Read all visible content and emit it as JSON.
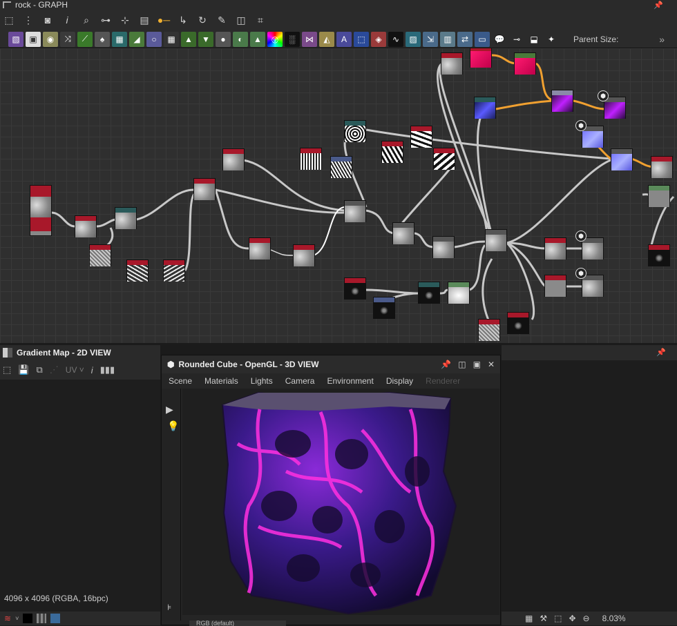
{
  "graph": {
    "title": "rock - GRAPH",
    "parent_size_label": "Parent Size:",
    "more": "»",
    "toolbar_icons": [
      "frame-icon",
      "nodes-icon",
      "camera-icon",
      "info-icon",
      "search-icon",
      "link-icon",
      "tree-icon",
      "layers-icon",
      "connect-icon",
      "curve-icon",
      "refresh-icon",
      "wrench-icon",
      "snapshot-icon",
      "crop-icon"
    ],
    "node_icons": [
      "bitmap-icon",
      "svg-icon",
      "levels-icon",
      "blend-icon",
      "curve-icon",
      "drop-icon",
      "tile-icon",
      "gradient-icon",
      "circle-icon",
      "grid-icon",
      "output-icon",
      "input-icon",
      "value-icon",
      "mask-icon",
      "histogram-icon",
      "color-wheel-icon",
      "noise-icon",
      "warp-icon",
      "distance-icon",
      "text-icon",
      "transform-icon",
      "fill-icon",
      "random-icon",
      "map-icon",
      "export-icon",
      "import-icon",
      "frame-icon",
      "comment-icon",
      "pin-icon",
      "star-icon"
    ]
  },
  "view2d": {
    "title": "Gradient Map - 2D VIEW",
    "uv_label": "UV",
    "info": "4096 x 4096 (RGBA, 16bpc)"
  },
  "view3d": {
    "title": "Rounded Cube - OpenGL - 3D VIEW",
    "menu": [
      "Scene",
      "Materials",
      "Lights",
      "Camera",
      "Environment",
      "Display",
      "Renderer"
    ],
    "status": "RGB (default)"
  },
  "right": {
    "zoom": "8.03%"
  },
  "colors": {
    "accent_pink": "#e020d0",
    "accent_purple": "#7a30ff",
    "node_header_red": "#a8182a"
  }
}
